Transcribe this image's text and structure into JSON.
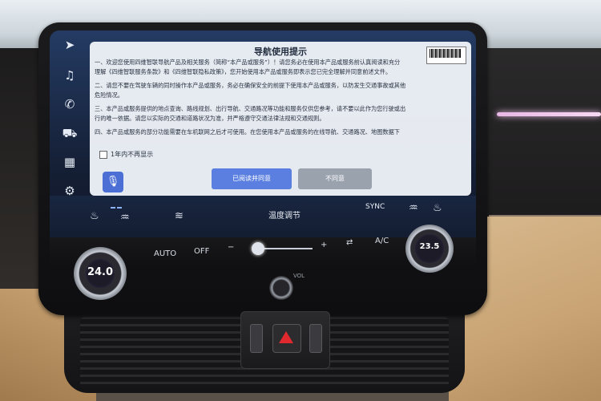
{
  "dialog": {
    "title": "导航使用提示",
    "lines": [
      "一、欢迎您使用四维智联导航产品及相关服务（简称“本产品或服务”）！请您务必在使用本产品或服务前认真阅读和充分",
      "理解《四维智联服务条款》和《四维智联隐私政策》，您开始使用本产品或服务即表示您已完全理解并同意前述文件。",
      "二、请您不要在驾驶车辆的同时操作本产品或服务，务必在确保安全的前提下使用本产品或服务，以防发生交通事故或其他",
      "危险情况。",
      "三、本产品或服务提供的地点查询、路线规划、出行导航、交通路况等功能和服务仅供您参考，请不要以此作为您行驶或出",
      "行的唯一依据。请您以实际的交通和道路状况为准，并严格遵守交通法律法规和交通规则。",
      "四、本产品或服务的部分功能需要在车机联网之后才可使用。在您使用本产品或服务的在线导航、交通路况、地图数据下"
    ],
    "checkbox_label": "1年内不再显示",
    "agree_label": "已阅读并同意",
    "disagree_label": "不同意",
    "agree_color": "#5a7fe0",
    "disagree_color": "#9aa2ae"
  },
  "sidebar": {
    "icons": [
      "navigation-icon",
      "music-icon",
      "phone-icon",
      "car-icon",
      "apps-icon",
      "settings-icon"
    ]
  },
  "climate": {
    "title": "温度调节",
    "sync": "SYNC",
    "auto": "AUTO",
    "off": "OFF",
    "ac": "A/C",
    "minus": "−",
    "plus": "+",
    "fan_level": 0.05,
    "left_temp": "24.0",
    "right_temp": "23.5"
  },
  "console": {
    "vol_label": "VOL"
  }
}
